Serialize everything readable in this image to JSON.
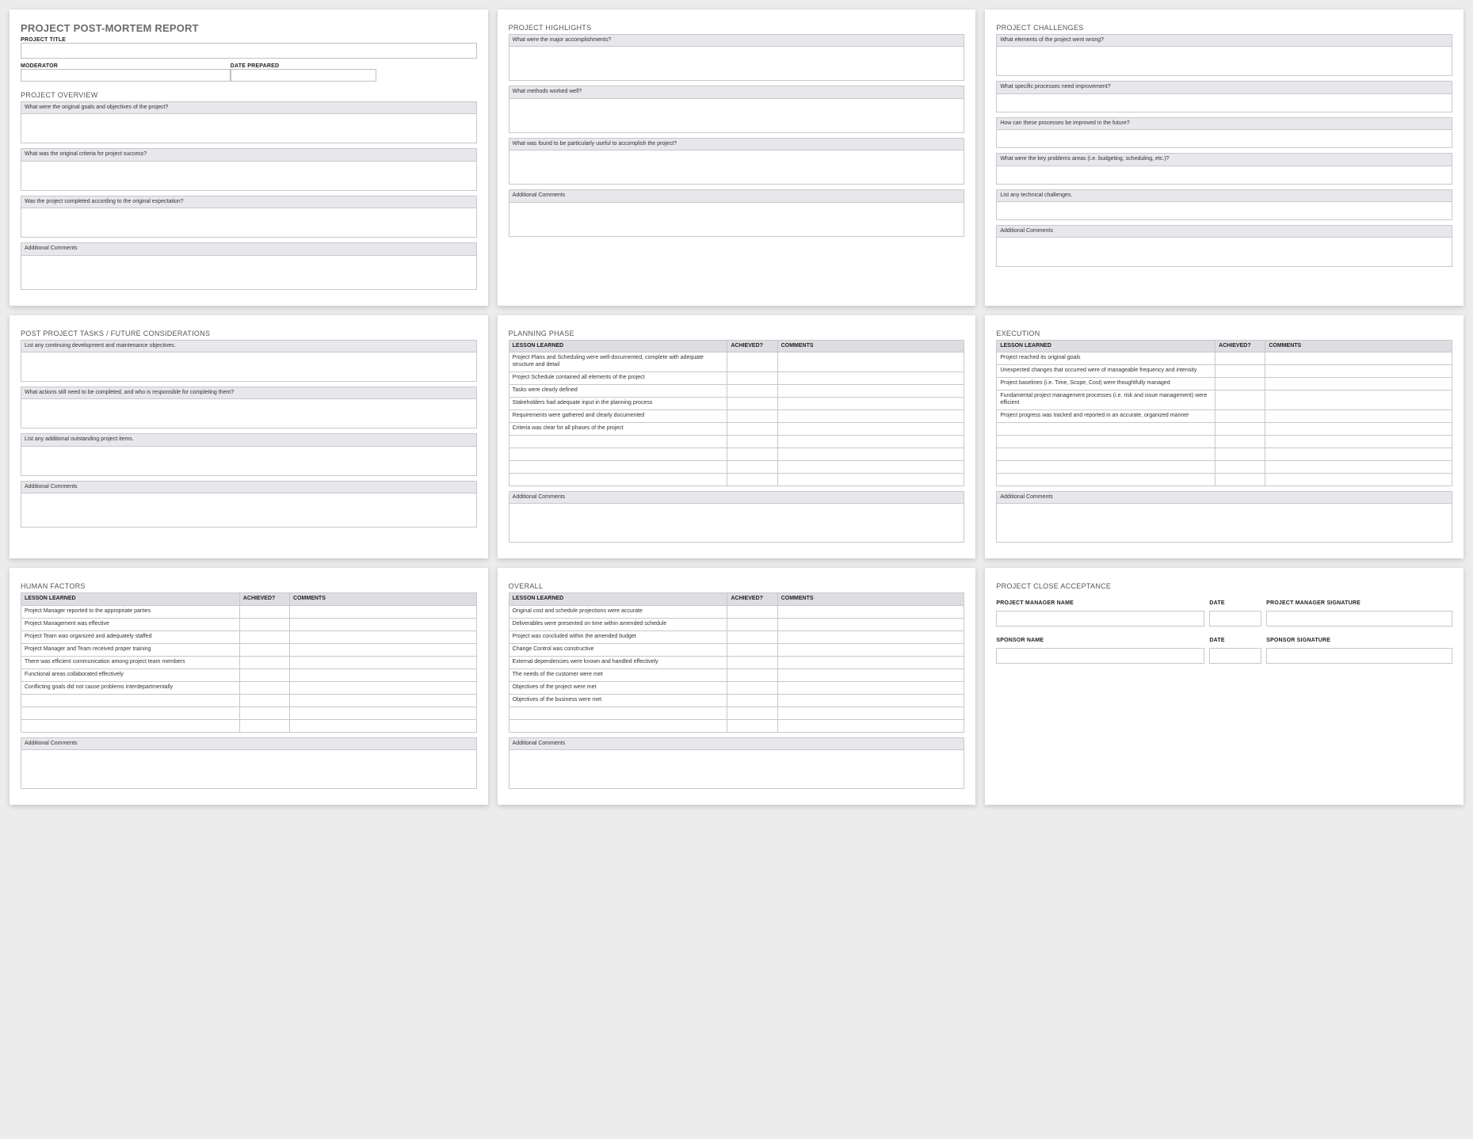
{
  "report": {
    "title": "PROJECT POST-MORTEM REPORT",
    "project_title_label": "PROJECT TITLE",
    "moderator_label": "MODERATOR",
    "date_prepared_label": "DATE PREPARED",
    "overview_title": "PROJECT OVERVIEW",
    "q_goals": "What were the original goals and objectives of the project?",
    "q_criteria": "What was the original criteria for project success?",
    "q_completed": "Was the project completed according to the original expectation?",
    "additional_comments": "Additional Comments"
  },
  "highlights": {
    "title": "PROJECT HIGHLIGHTS",
    "q_accomplishments": "What were the major accomplishments?",
    "q_methods": "What methods worked well?",
    "q_useful": "What was found to be particularly useful to accomplish the project?",
    "additional_comments": "Additional Comments"
  },
  "challenges": {
    "title": "PROJECT CHALLENGES",
    "q_wrong": "What elements of the project went wrong?",
    "q_processes": "What specific processes need improvement?",
    "q_improve": "How can these processes be improved in the future?",
    "q_problem_areas": "What were the key problems areas (i.e. budgeting, scheduling, etc.)?",
    "q_technical": "List any technical challenges.",
    "additional_comments": "Additional Comments"
  },
  "postproject": {
    "title": "POST PROJECT TASKS / FUTURE CONSIDERATIONS",
    "q_continuing": "List any continuing development and maintenance objectives.",
    "q_actions": "What actions still need to be completed, and who is responsible for completing them?",
    "q_outstanding": "List any additional outstanding project items.",
    "additional_comments": "Additional Comments"
  },
  "planning": {
    "title": "PLANNING PHASE",
    "additional_comments": "Additional Comments",
    "headers": {
      "lesson": "LESSON LEARNED",
      "achieved": "ACHIEVED?",
      "comments": "COMMENTS"
    },
    "rows": [
      "Project Plans and Scheduling were well-documented, complete with adequate structure and detail",
      "Project Schedule contained all elements of the project",
      "Tasks were clearly defined",
      "Stakeholders had adequate input in the planning process",
      "Requirements were gathered and clearly documented",
      "Criteria was clear for all phases of the project",
      "",
      "",
      "",
      ""
    ]
  },
  "execution": {
    "title": "EXECUTION",
    "additional_comments": "Additional Comments",
    "headers": {
      "lesson": "LESSON LEARNED",
      "achieved": "ACHIEVED?",
      "comments": "COMMENTS"
    },
    "rows": [
      "Project reached its original goals",
      "Unexpected changes that occurred were of manageable frequency and intensity",
      "Project baselines (i.e. Time, Scope, Cost) were thoughtfully managed",
      "Fundamental project management processes (i.e. risk and issue management) were efficient",
      "Project progress was tracked and reported in an accurate, organized manner",
      "",
      "",
      "",
      "",
      ""
    ]
  },
  "human": {
    "title": "HUMAN FACTORS",
    "additional_comments": "Additional Comments",
    "headers": {
      "lesson": "LESSON LEARNED",
      "achieved": "ACHIEVED?",
      "comments": "COMMENTS"
    },
    "rows": [
      "Project Manager reported to the appropriate parties",
      "Project Management was effective",
      "Project Team was organized and adequately staffed",
      "Project Manager and Team received proper training",
      "There was efficient communication among project team members",
      "Functional areas collaborated effectively",
      "Conflicting goals did not cause problems interdepartmentally",
      "",
      "",
      ""
    ]
  },
  "overall": {
    "title": "OVERALL",
    "additional_comments": "Additional Comments",
    "headers": {
      "lesson": "LESSON LEARNED",
      "achieved": "ACHIEVED?",
      "comments": "COMMENTS"
    },
    "rows": [
      "Original cost and schedule projections were accurate",
      "Deliverables were presented on time within amended schedule",
      "Project was concluded within the amended budget",
      "Change Control was constructive",
      "External dependencies were known and handled effectively",
      "The needs of the customer were met",
      "Objectives of the project were met",
      "Objectives of the business were met",
      "",
      ""
    ]
  },
  "close": {
    "title": "PROJECT CLOSE ACCEPTANCE",
    "pm_name": "PROJECT MANAGER NAME",
    "date": "DATE",
    "pm_sig": "PROJECT MANAGER SIGNATURE",
    "sponsor_name": "SPONSOR NAME",
    "sponsor_sig": "SPONSOR SIGNATURE"
  }
}
